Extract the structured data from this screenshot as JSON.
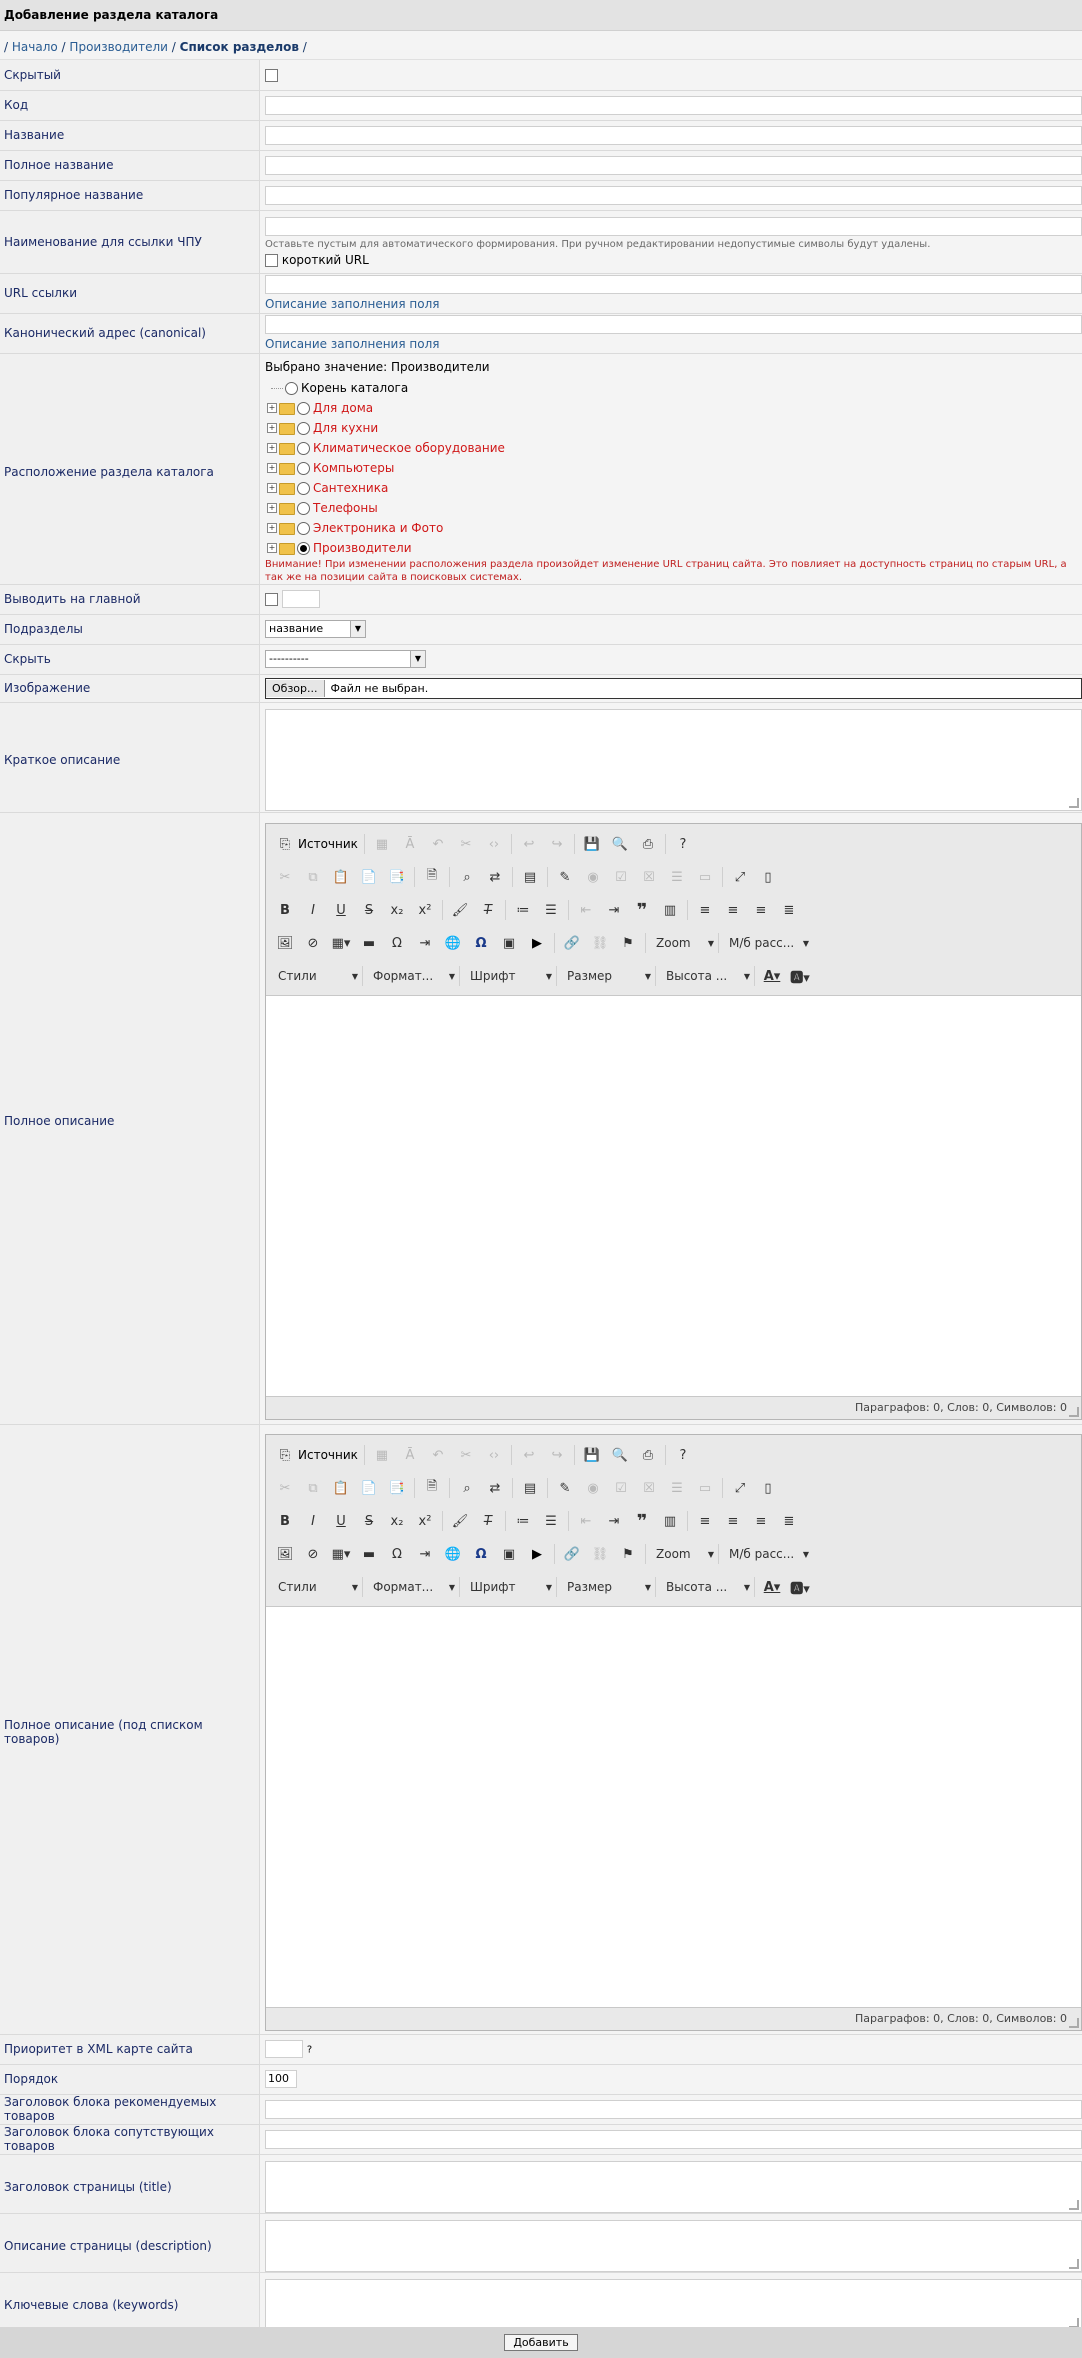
{
  "header": {
    "title": "Добавление раздела каталога"
  },
  "breadcrumb": {
    "home": "Начало",
    "maker": "Производители",
    "current": "Список разделов",
    "sep": "/"
  },
  "fields": {
    "hidden": "Скрытый",
    "code": "Код",
    "name": "Название",
    "full_name": "Полное название",
    "popular_name": "Популярное название",
    "slug": "Наименование для ссылки ЧПУ",
    "slug_hint": "Оставьте пустым для автоматического формирования. При ручном редактировании недопустимые символы будут удалены.",
    "short_url": "короткий URL",
    "url": "URL ссылки",
    "fill_desc": "Описание заполнения поля",
    "canonical": "Канонический адрес (canonical)",
    "location": "Расположение раздела каталога",
    "selected": "Выбрано значение: Производители",
    "warning": "Внимание! При изменении расположения раздела произойдет изменение URL страниц сайта. Это повлияет на доступность страниц по старым URL, а так же на позиции сайта в поисковых системах.",
    "on_main": "Выводить на главной",
    "subsections": "Подразделы",
    "subsections_value": "название",
    "hide": "Скрыть",
    "hide_value": "----------",
    "image": "Изображение",
    "browse": "Обзор...",
    "no_file": "Файл не выбран.",
    "short_desc": "Краткое описание",
    "full_desc": "Полное описание",
    "full_desc_below": "Полное описание (под списком товаров)",
    "xml_priority": "Приоритет в XML карте сайта",
    "xml_q": "?",
    "order": "Порядок",
    "order_value": "100",
    "recommended": "Заголовок блока рекомендуемых товаров",
    "related": "Заголовок блока сопутствующих товаров",
    "title": "Заголовок страницы (title)",
    "description": "Описание страницы (description)",
    "keywords": "Ключевые слова (keywords)"
  },
  "tree": {
    "root": "Корень каталога",
    "items": [
      "Для дома",
      "Для кухни",
      "Климатическое оборудование",
      "Компьютеры",
      "Сантехника",
      "Телефоны",
      "Электроника и Фото",
      "Производители"
    ]
  },
  "editor": {
    "source": "Источник",
    "zoom": "Zoom",
    "spacing": "М/б расс...",
    "styles": "Стили",
    "format": "Формат...",
    "font": "Шрифт",
    "size": "Размер",
    "height": "Высота ...",
    "status": "Параграфов: 0, Слов: 0, Символов: 0"
  },
  "submit": "Добавить"
}
